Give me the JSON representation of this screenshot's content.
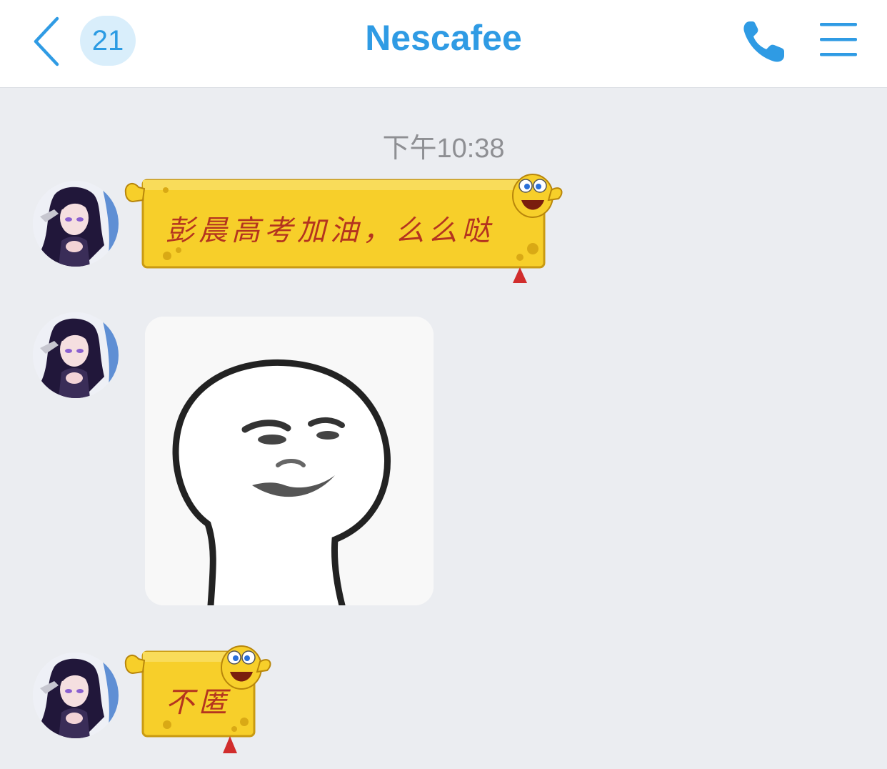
{
  "header": {
    "back_icon": "chevron-left-icon",
    "unread_count": "21",
    "title": "Nescafee",
    "call_icon": "phone-icon",
    "menu_icon": "hamburger-menu-icon"
  },
  "colors": {
    "accent": "#2f9be4",
    "badge_bg": "#d9eefb",
    "chat_bg": "#ebedf1",
    "bubble_yellow": "#f7cf2a",
    "bubble_text": "#b4341f"
  },
  "chat": {
    "timestamp": "下午10:38",
    "messages": [
      {
        "type": "text",
        "bubble_style": "spongebob-sponge",
        "text": "彭晨高考加油，么么哒"
      },
      {
        "type": "sticker",
        "sticker_icon": "round-head-smirk-meme"
      },
      {
        "type": "text",
        "bubble_style": "spongebob-sponge",
        "text": "不匿"
      }
    ]
  }
}
